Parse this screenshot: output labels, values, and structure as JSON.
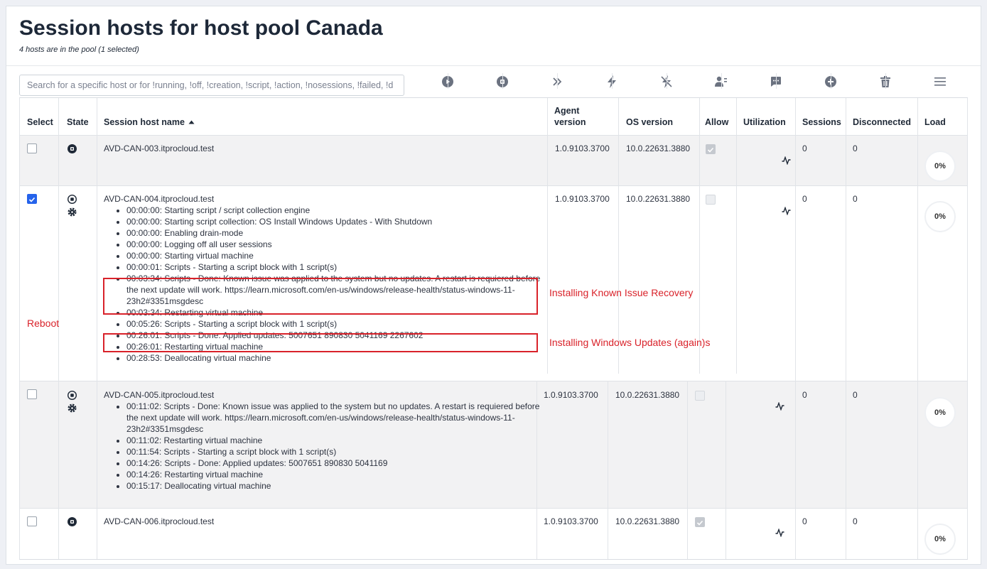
{
  "page": {
    "title": "Session hosts for host pool Canada",
    "subtitle": "4 hosts are in the pool (1 selected)"
  },
  "search": {
    "placeholder": "Search for a specific host or for !running, !off, !creation, !script, !action, !nosessions, !failed, !d"
  },
  "toolbar": {
    "icons": [
      "play-icon",
      "stop-icon",
      "fast-forward-icon",
      "lightning-icon",
      "lightning-off-icon",
      "user-action-icon",
      "message-icon",
      "add-icon",
      "trash-icon",
      "menu-icon"
    ]
  },
  "columns": {
    "select": "Select",
    "state": "State",
    "name": "Session host name",
    "agent_l1": "Agent",
    "agent_l2": "version",
    "os": "OS version",
    "allow": "Allow",
    "utilization": "Utilization",
    "sessions": "Sessions",
    "disconnected": "Disconnected",
    "load": "Load"
  },
  "rows": [
    {
      "name": "AVD-CAN-003.itprocloud.test",
      "agent": "1.0.9103.3700",
      "os": "10.0.22631.3880",
      "sessions": "0",
      "disconnected": "0",
      "load": "0%",
      "selected": false,
      "allow": true,
      "logs": []
    },
    {
      "name": "AVD-CAN-004.itprocloud.test",
      "agent": "1.0.9103.3700",
      "os": "10.0.22631.3880",
      "sessions": "0",
      "disconnected": "0",
      "load": "0%",
      "selected": true,
      "allow": false,
      "logs": [
        "00:00:00: Starting script / script collection engine",
        "00:00:00: Starting script collection: OS Install Windows Updates - With Shutdown",
        "00:00:00: Enabling drain-mode",
        "00:00:00: Logging off all user sessions",
        "00:00:00: Starting virtual machine",
        "00:00:01: Scripts - Starting a script block with 1 script(s)",
        "00:03:34: Scripts - Done: Known issue was applied to the system but no updates. A restart is requiered before the next update will work. https://learn.microsoft.com/en-us/windows/release-health/status-windows-11-23h2#3351msgdesc",
        "00:03:34: Restarting virtual machine",
        "00:05:26: Scripts - Starting a script block with 1 script(s)",
        "00:26:01: Scripts - Done: Applied updates: 5007651 890830 5041169 2267602",
        "00:26:01: Restarting virtual machine",
        "00:28:53: Deallocating virtual machine"
      ]
    },
    {
      "name": "AVD-CAN-005.itprocloud.test",
      "agent": "1.0.9103.3700",
      "os": "10.0.22631.3880",
      "sessions": "0",
      "disconnected": "0",
      "load": "0%",
      "selected": false,
      "allow": false,
      "logs": [
        "00:11:02: Scripts - Done: Known issue was applied to the system but no updates. A restart is requiered before the next update will work. https://learn.microsoft.com/en-us/windows/release-health/status-windows-11-23h2#3351msgdesc",
        "00:11:02: Restarting virtual machine",
        "00:11:54: Scripts - Starting a script block with 1 script(s)",
        "00:14:26: Scripts - Done: Applied updates: 5007651 890830 5041169",
        "00:14:26: Restarting virtual machine",
        "00:15:17: Deallocating virtual machine"
      ]
    },
    {
      "name": "AVD-CAN-006.itprocloud.test",
      "agent": "1.0.9103.3700",
      "os": "10.0.22631.3880",
      "sessions": "0",
      "disconnected": "0",
      "load": "0%",
      "selected": false,
      "allow": true,
      "logs": []
    }
  ],
  "annotations": {
    "reboot": "Reboot",
    "known_issue": "Installing Known Issue Recovery",
    "updates_again": "Installing Windows Updates (again)s"
  },
  "colors": {
    "accent": "#2563eb",
    "annotation": "#d9222a",
    "row_alt": "#f2f2f3"
  }
}
